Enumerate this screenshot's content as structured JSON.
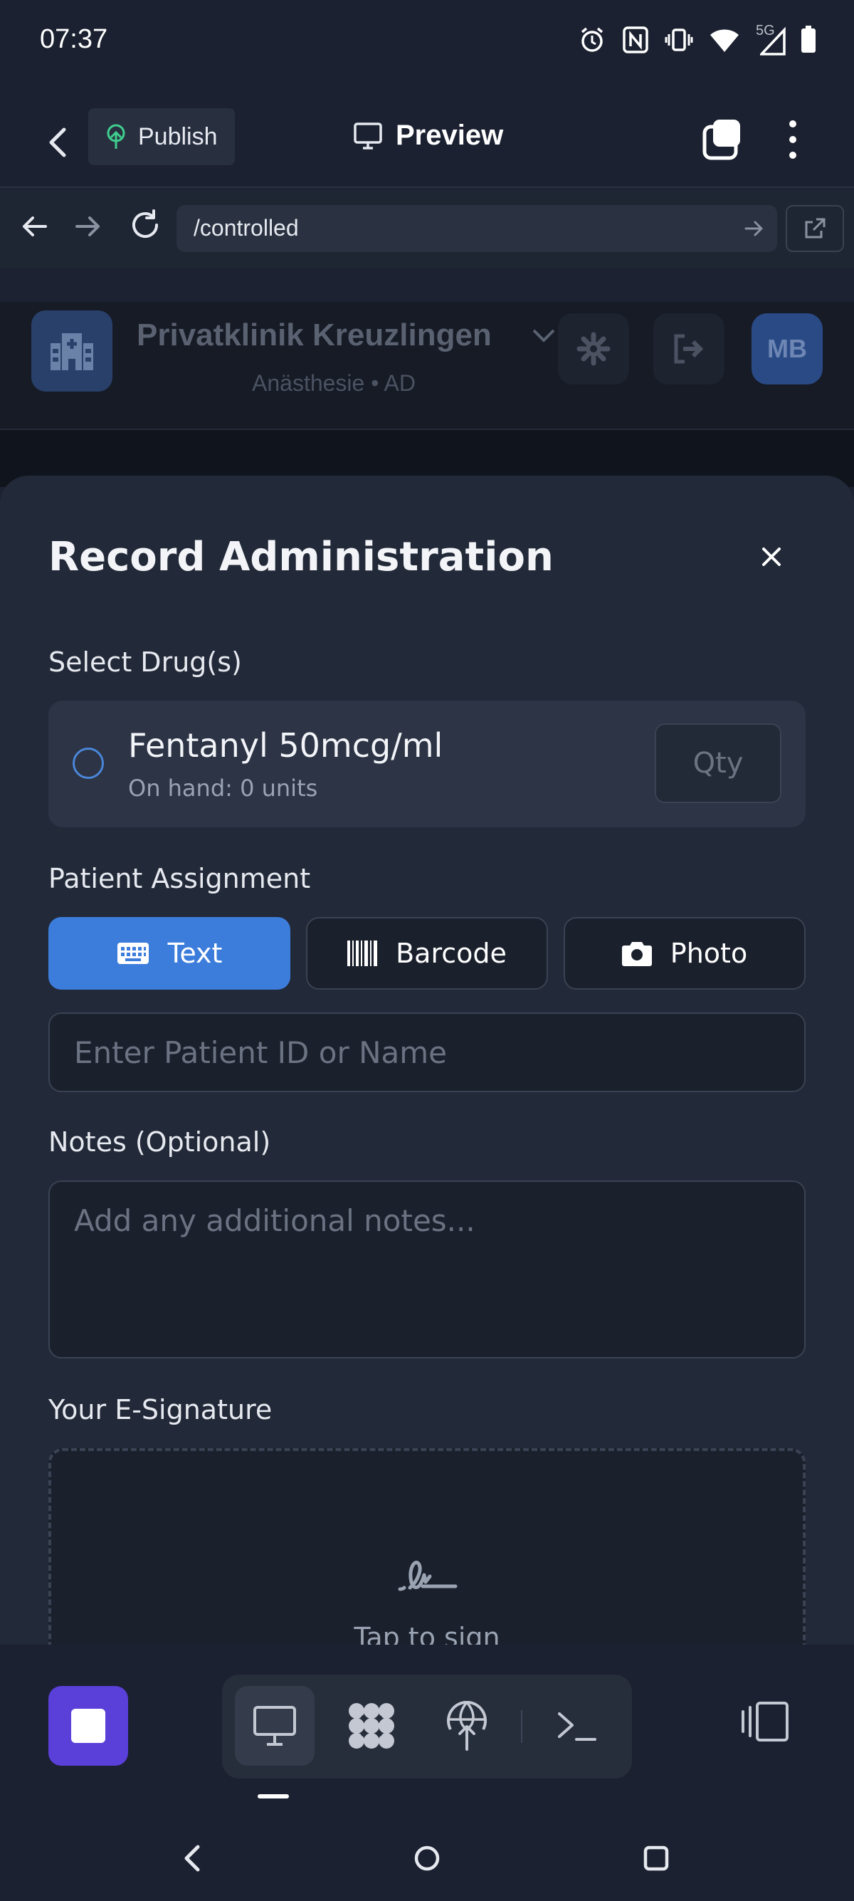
{
  "status_bar": {
    "time": "07:37",
    "network": "5G",
    "icons": [
      "alarm-icon",
      "nfc-icon",
      "vibrate-icon",
      "wifi-icon",
      "signal-icon",
      "battery-icon"
    ]
  },
  "app_bar": {
    "publish_label": "Publish",
    "preview_label": "Preview"
  },
  "browser": {
    "url": "/controlled"
  },
  "page": {
    "clinic_name": "Privatklinik Kreuzlingen",
    "clinic_subtitle": "Anästhesie • AD",
    "avatar_initials": "MB"
  },
  "modal": {
    "title": "Record Administration",
    "select_drug_label": "Select Drug(s)",
    "drugs": [
      {
        "name": "Fentanyl 50mcg/ml",
        "on_hand": "On hand: 0 units",
        "qty_placeholder": "Qty"
      }
    ],
    "patient_label": "Patient Assignment",
    "patient_modes": [
      {
        "label": "Text",
        "icon": "keyboard-icon",
        "active": true
      },
      {
        "label": "Barcode",
        "icon": "barcode-icon",
        "active": false
      },
      {
        "label": "Photo",
        "icon": "camera-icon",
        "active": false
      }
    ],
    "patient_placeholder": "Enter Patient ID or Name",
    "notes_label": "Notes (Optional)",
    "notes_placeholder": "Add any additional notes...",
    "signature_label": "Your E-Signature",
    "signature_hint": "Tap to sign"
  },
  "colors": {
    "accent": "#3c7ddb",
    "stop": "#5a3fd9",
    "background": "#1b2130",
    "sheet": "#222938"
  }
}
